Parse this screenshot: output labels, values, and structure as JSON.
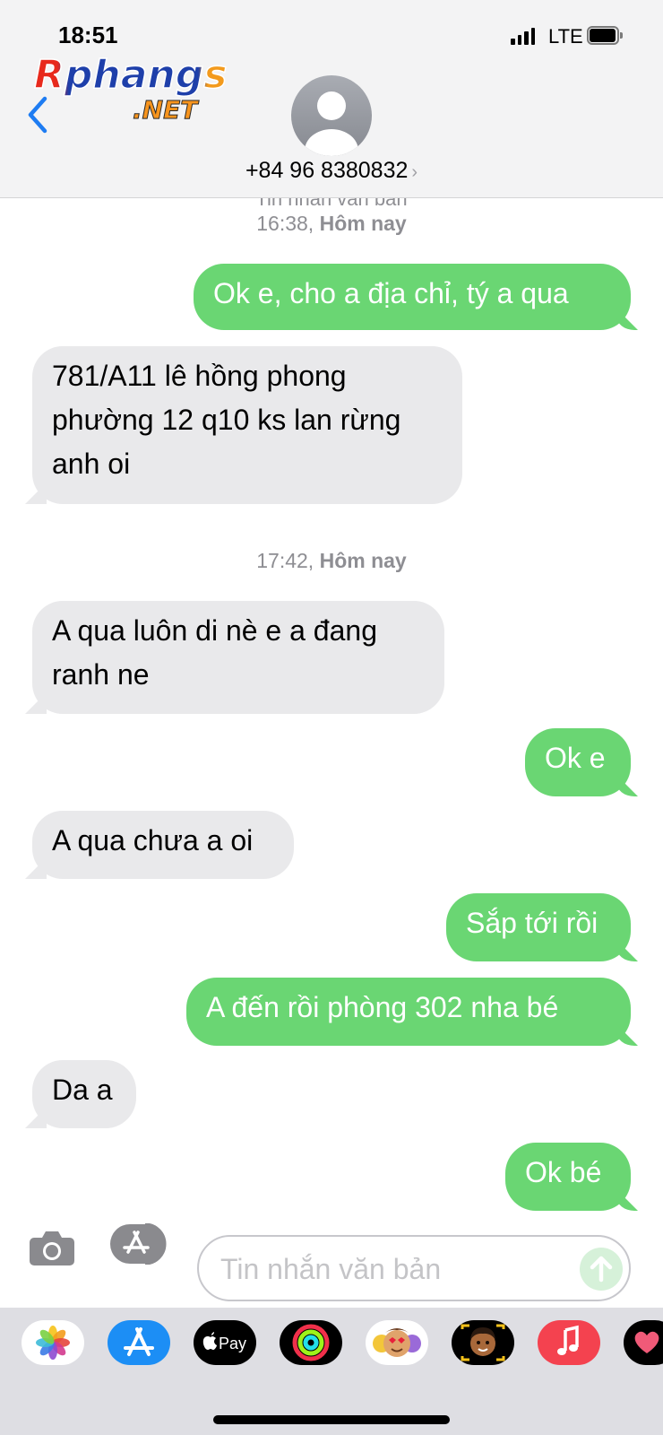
{
  "status_bar": {
    "time": "18:51",
    "network": "LTE"
  },
  "watermark": {
    "main": "Rphangs",
    "sub": ".NET"
  },
  "header": {
    "contact": "+84 96 8380832"
  },
  "conversation": {
    "cut_off_label": "Tin nhắn văn bản",
    "timestamps": [
      {
        "time": "16:38,",
        "day": "Hôm nay"
      },
      {
        "time": "17:42,",
        "day": "Hôm nay"
      }
    ],
    "messages": [
      {
        "direction": "outgoing",
        "text": "Ok e, cho a địa chỉ, tý a qua"
      },
      {
        "direction": "incoming",
        "text": "781/A11 lê hồng phong phường 12 q10 ks lan rừng anh oi"
      },
      {
        "direction": "incoming",
        "text": "A qua luôn di nè e a đang ranh ne"
      },
      {
        "direction": "outgoing",
        "text": "Ok e"
      },
      {
        "direction": "incoming",
        "text": "A qua chưa a oi"
      },
      {
        "direction": "outgoing",
        "text": "Sắp tới rồi"
      },
      {
        "direction": "outgoing",
        "text": "A đến rồi phòng 302 nha bé"
      },
      {
        "direction": "incoming",
        "text": "Da a"
      },
      {
        "direction": "outgoing",
        "text": "Ok bé"
      }
    ]
  },
  "composer": {
    "placeholder": "Tin nhắn văn bản",
    "value": ""
  },
  "app_drawer": {
    "apps": [
      {
        "icon": "photos-icon"
      },
      {
        "icon": "app-store-icon"
      },
      {
        "icon": "apple-pay-icon",
        "label": "Pay"
      },
      {
        "icon": "activity-icon"
      },
      {
        "icon": "memoji-stickers-icon"
      },
      {
        "icon": "memoji-icon"
      },
      {
        "icon": "music-icon"
      },
      {
        "icon": "digital-touch-icon"
      }
    ]
  },
  "colors": {
    "outgoing_bubble": "#6ad673",
    "incoming_bubble": "#e9e9eb",
    "accent": "#1e7cf2",
    "timestamp": "#8e8e93"
  }
}
